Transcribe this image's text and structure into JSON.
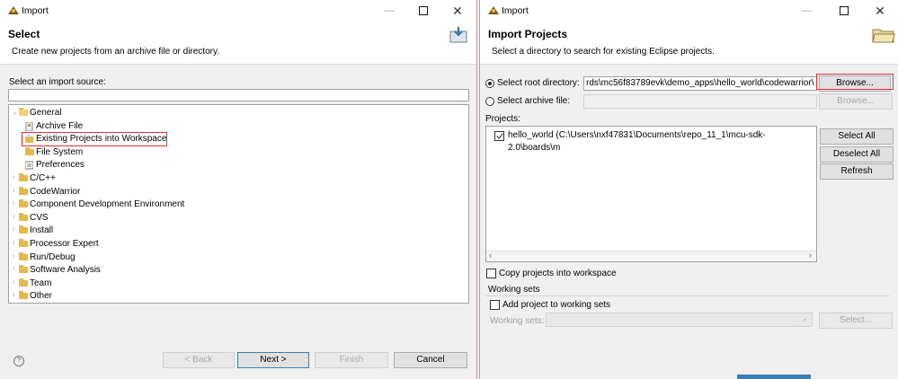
{
  "left": {
    "window_title": "Import",
    "header_title": "Select",
    "header_desc": "Create new projects from an archive file or directory.",
    "source_label": "Select an import source:",
    "filter_value": "",
    "tree": [
      {
        "label": "General",
        "kind": "folder",
        "expanded": true,
        "level": 0
      },
      {
        "label": "Archive File",
        "kind": "archive-file",
        "level": 1
      },
      {
        "label": "Existing Projects into Workspace",
        "kind": "projects",
        "level": 1,
        "highlighted": true
      },
      {
        "label": "File System",
        "kind": "folder",
        "level": 1
      },
      {
        "label": "Preferences",
        "kind": "preferences",
        "level": 1
      },
      {
        "label": "C/C++",
        "kind": "folder",
        "level": 0
      },
      {
        "label": "CodeWarrior",
        "kind": "folder",
        "level": 0
      },
      {
        "label": "Component Development Environment",
        "kind": "folder",
        "level": 0
      },
      {
        "label": "CVS",
        "kind": "folder",
        "level": 0
      },
      {
        "label": "Install",
        "kind": "folder",
        "level": 0
      },
      {
        "label": "Processor Expert",
        "kind": "folder",
        "level": 0
      },
      {
        "label": "Run/Debug",
        "kind": "folder",
        "level": 0
      },
      {
        "label": "Software Analysis",
        "kind": "folder",
        "level": 0
      },
      {
        "label": "Team",
        "kind": "folder",
        "level": 0
      },
      {
        "label": "Other",
        "kind": "folder",
        "level": 0
      }
    ],
    "buttons": {
      "back": "< Back",
      "next": "Next >",
      "finish": "Finish",
      "cancel": "Cancel"
    },
    "help_icon": "?"
  },
  "right": {
    "window_title": "Import",
    "header_title": "Import Projects",
    "header_desc": "Select a directory to search for existing Eclipse projects.",
    "root_dir_label": "Select root directory:",
    "root_dir_value": "rds\\mc56f83789evk\\demo_apps\\hello_world\\codewarrior\\",
    "archive_label": "Select archive file:",
    "archive_value": "",
    "browse_label": "Browse...",
    "browse_disabled_label": "Browse...",
    "projects_label": "Projects:",
    "project_item": "hello_world (C:\\Users\\nxf47831\\Documents\\repo_11_1\\mcu-sdk-2.0\\boards\\m",
    "select_all": "Select All",
    "deselect_all": "Deselect All",
    "refresh": "Refresh",
    "copy_projects": "Copy projects into workspace",
    "working_sets_group": "Working sets",
    "add_to_working_sets": "Add project to working sets",
    "working_sets_label": "Working sets:",
    "working_sets_value": "",
    "select_button": "Select..."
  },
  "colors": {
    "highlight": "#e0303a",
    "folder": "#e3b94e"
  }
}
